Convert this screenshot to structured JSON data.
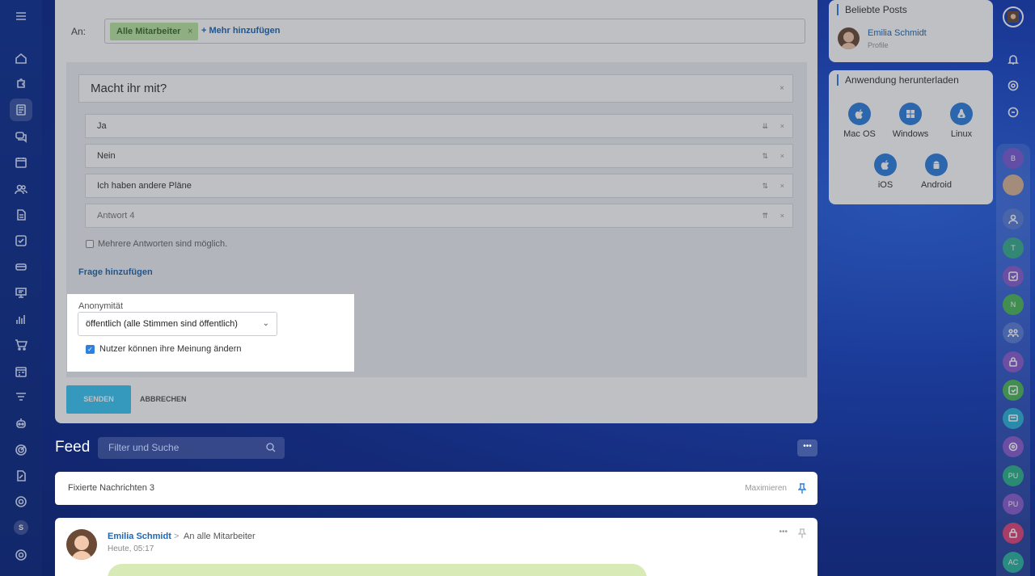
{
  "recipients": {
    "label": "An:",
    "chip": "Alle Mitarbeiter",
    "chip_remove": "×",
    "add_more": "+ Mehr hinzufügen"
  },
  "poll": {
    "question": "Macht ihr mit?",
    "answers": [
      {
        "text": "Ja",
        "placeholder": false
      },
      {
        "text": "Nein",
        "placeholder": false
      },
      {
        "text": "Ich haben andere Pläne",
        "placeholder": false
      },
      {
        "text": "Antwort  4",
        "placeholder": true
      }
    ],
    "multiple_answers_label": "Mehrere Antworten sind möglich.",
    "multiple_answers_checked": false,
    "add_question": "Frage hinzufügen"
  },
  "anonymity": {
    "label": "Anonymität",
    "selected": "öffentlich (alle Stimmen sind öffentlich)",
    "change_opinion_label": "Nutzer können ihre Meinung ändern",
    "change_opinion_checked": true
  },
  "actions": {
    "send": "SENDEN",
    "cancel": "ABBRECHEN"
  },
  "feed": {
    "title": "Feed",
    "search_placeholder": "Filter und Suche",
    "more": "•••",
    "pinned_label": "Fixierte Nachrichten",
    "pinned_count": "3",
    "maximize": "Maximieren"
  },
  "post": {
    "author": "Emilia Schmidt",
    "arrow": ">",
    "recipient": "An alle Mitarbeiter",
    "time": "Heute, 05:17",
    "more": "•••"
  },
  "popular_posts": {
    "title": "Beliebte Posts",
    "name": "Emilia Schmidt",
    "sub": "Profile"
  },
  "download": {
    "title": "Anwendung herunterladen",
    "apps": [
      {
        "name": "Mac OS",
        "icon": "apple-icon"
      },
      {
        "name": "Windows",
        "icon": "windows-icon"
      },
      {
        "name": "Linux",
        "icon": "linux-icon"
      },
      {
        "name": "iOS",
        "icon": "apple-icon"
      },
      {
        "name": "Android",
        "icon": "android-icon"
      }
    ]
  },
  "left_sidebar": {
    "badge": "S"
  },
  "right_sidebar": {
    "avatars": [
      {
        "text": "B",
        "color": "#7c5cd6"
      },
      {
        "text": "T",
        "color": "#3cae8e"
      },
      {
        "text": "N",
        "color": "#4cb85a"
      },
      {
        "text": "PU",
        "color": "#2bb38a"
      },
      {
        "text": "PU",
        "color": "#8a5ccf"
      },
      {
        "text": "AC",
        "color": "#2bb3a0"
      }
    ]
  },
  "colors": {
    "accent": "#2f7fdd",
    "send": "#3bc8f5",
    "chip": "#bce7a3",
    "link": "#2067b0"
  }
}
